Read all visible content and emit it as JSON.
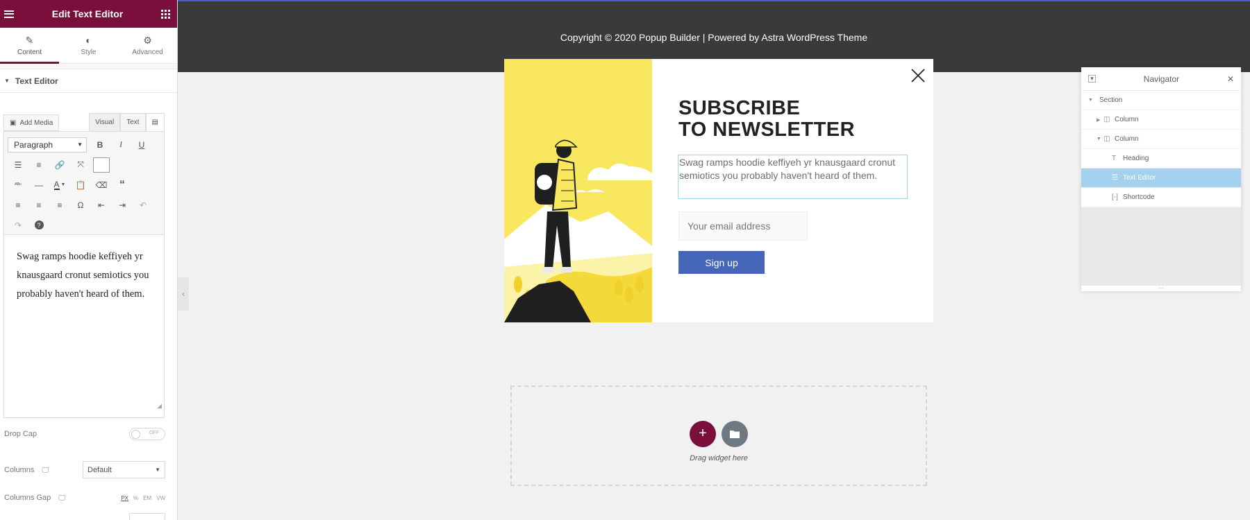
{
  "panel": {
    "title": "Edit Text Editor",
    "tabs": [
      {
        "label": "Content",
        "icon": "pencil-icon"
      },
      {
        "label": "Style",
        "icon": "half-circle-icon"
      },
      {
        "label": "Advanced",
        "icon": "gear-icon"
      }
    ],
    "section_title": "Text Editor",
    "add_media_label": "Add Media",
    "editor_tabs": [
      "Visual",
      "Text"
    ],
    "paragraph_select": "Paragraph",
    "editor_content": "Swag ramps hoodie keffiyeh yr knausgaard cronut semiotics you probably haven't heard of them.",
    "drop_cap": {
      "label": "Drop Cap",
      "toggle_text": "OFF"
    },
    "columns": {
      "label": "Columns",
      "value": "Default"
    },
    "columns_gap": {
      "label": "Columns Gap",
      "units": [
        "PX",
        "%",
        "EM",
        "VW"
      ]
    }
  },
  "canvas": {
    "copyright": "Copyright © 2020 Popup Builder | Powered by Astra WordPress Theme",
    "popup": {
      "title_line1": "SUBSCRIBE",
      "title_line2": "TO NEWSLETTER",
      "text": "Swag ramps hoodie keffiyeh yr knausgaard cronut semiotics you probably haven't heard of them.",
      "email_placeholder": "Your email address",
      "button_label": "Sign up"
    },
    "drop_zone_text": "Drag widget here"
  },
  "navigator": {
    "title": "Navigator",
    "items": [
      {
        "label": "Section"
      },
      {
        "label": "Column"
      },
      {
        "label": "Column"
      },
      {
        "label": "Heading"
      },
      {
        "label": "Text Editor"
      },
      {
        "label": "Shortcode"
      }
    ]
  },
  "colors": {
    "brand": "#7a0f3b",
    "footer_bg": "#3a3a3a",
    "popup_art_bg": "#f8e75f",
    "button_blue": "#4565b7",
    "nav_active": "#a4d1ed"
  }
}
